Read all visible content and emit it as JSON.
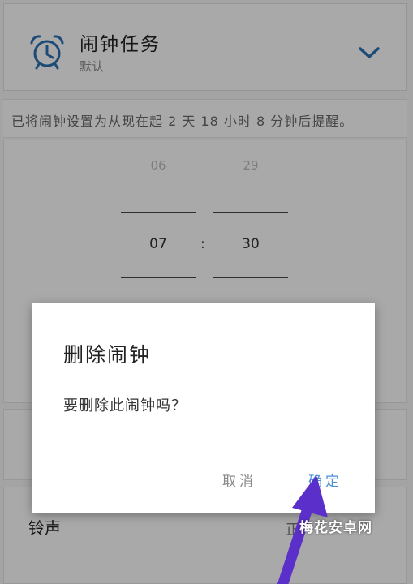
{
  "header": {
    "title": "闹钟任务",
    "subtitle": "默认",
    "icon": "alarm-clock-icon",
    "expand_icon": "chevron-down-icon",
    "accent": "#2c6fb0"
  },
  "info": {
    "text": "已将闹钟设置为从现在起 2 天 18 小时 8 分钟后提醒。"
  },
  "time_picker": {
    "hour_prev": "06",
    "minute_prev": "29",
    "hour": "07",
    "separator": ":",
    "minute": "30"
  },
  "rows": {
    "ringtone_label": "铃声",
    "ringtone_value": "正"
  },
  "dialog": {
    "title": "删除闹钟",
    "message": "要删除此闹钟吗？",
    "cancel_label": "取消",
    "confirm_label": "确定",
    "confirm_color": "#4a8fd4"
  },
  "watermark": "梅花安卓网",
  "arrow_color": "#5b2fc9"
}
